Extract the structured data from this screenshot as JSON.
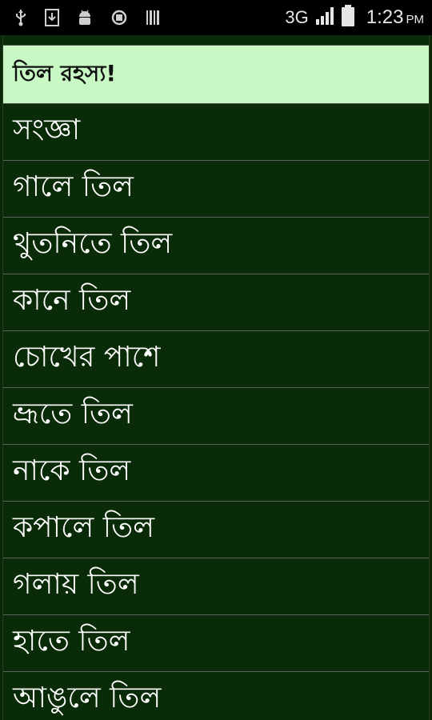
{
  "status_bar": {
    "icons": [
      "usb-icon",
      "download-icon",
      "android-debug-icon",
      "sync-icon",
      "barcode-icon"
    ],
    "network": "3G",
    "time": "1:23",
    "ampm": "PM"
  },
  "list": {
    "header": "তিল রহস্য!",
    "items": [
      "সংজ্ঞা",
      "গালে তিল",
      "থুতনিতে তিল",
      "কানে তিল",
      "চোখের পাশে",
      "ভ্রূতে তিল",
      "নাকে তিল",
      "কপালে তিল",
      "গলায় তিল",
      "হাতে তিল",
      "আঙুলে তিল"
    ]
  },
  "colors": {
    "background": "#0a2b07",
    "header_bg": "#c8f8c3",
    "divider": "#5a6458",
    "text": "#ffffff"
  }
}
